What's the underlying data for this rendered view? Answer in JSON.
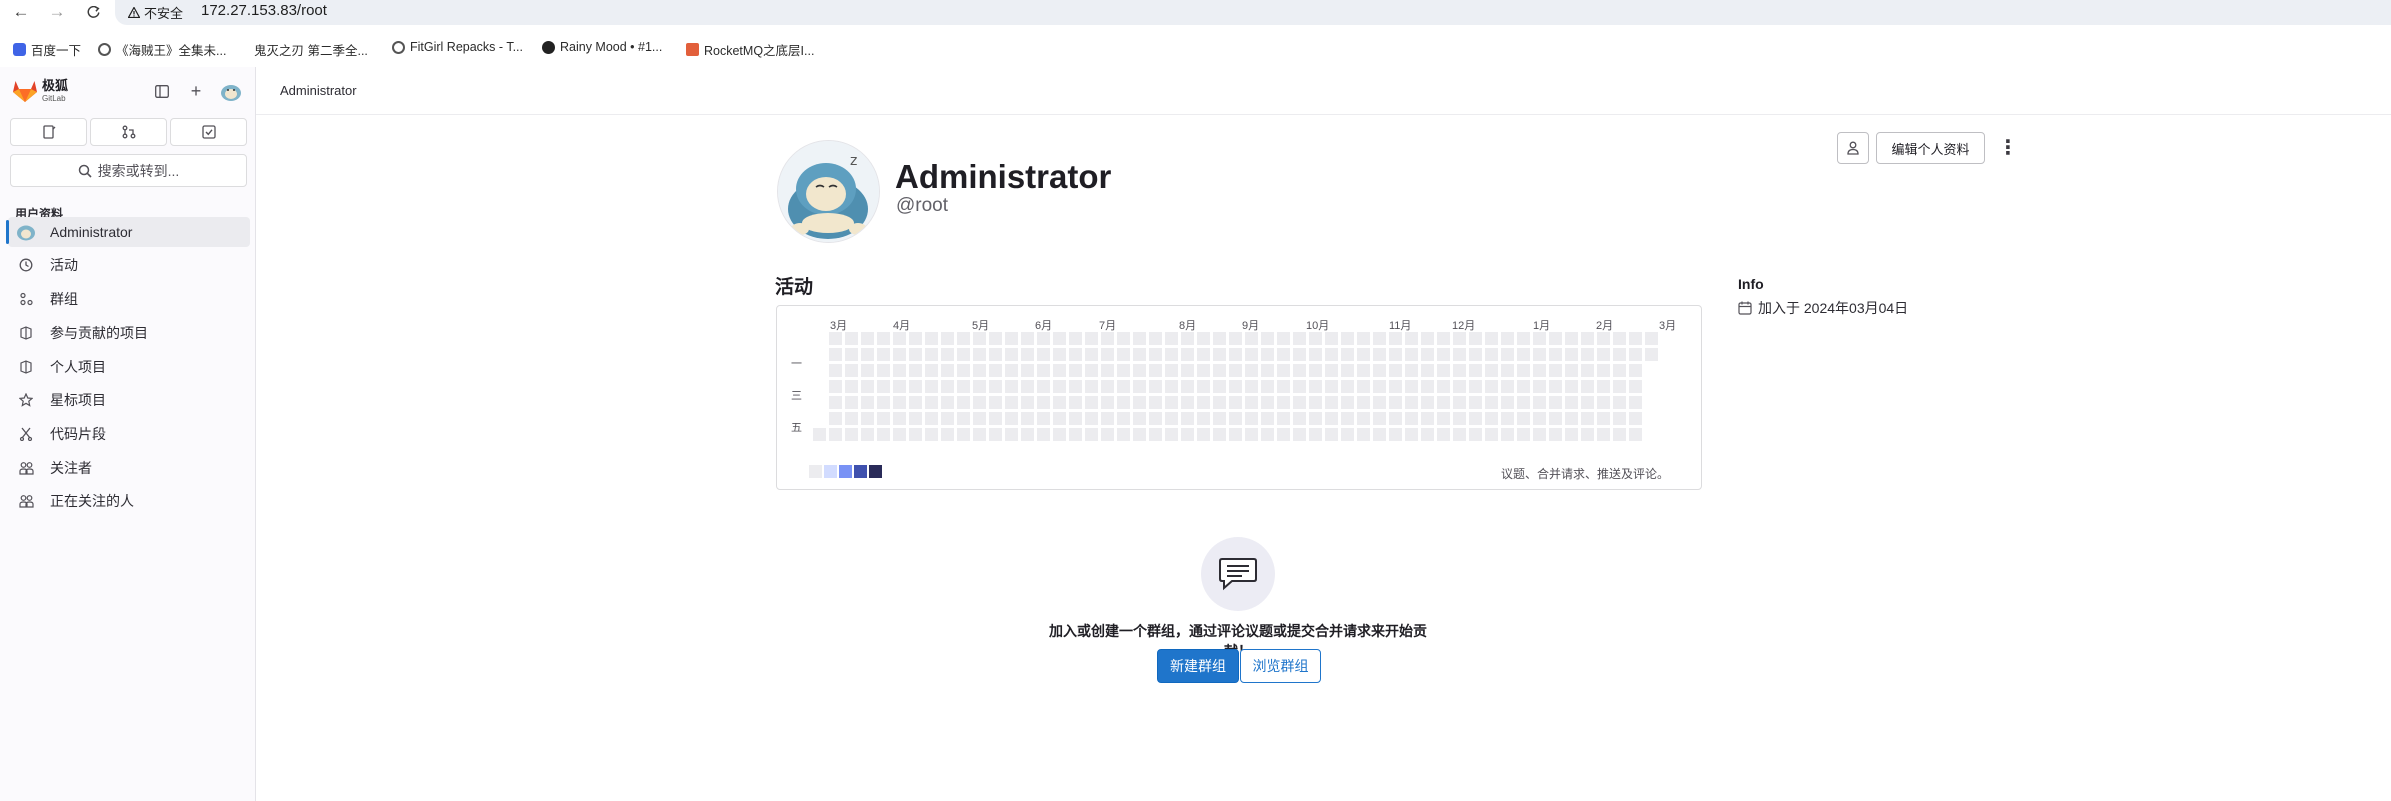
{
  "browser": {
    "insecure_label": "不安全",
    "url": "172.27.153.83/root"
  },
  "bookmarks": [
    {
      "label": "百度一下",
      "color": "#3f64e6"
    },
    {
      "label": "《海贼王》全集未...",
      "color": "#555555"
    },
    {
      "label": "鬼灭之刃 第二季全...",
      "color": "#ffffff"
    },
    {
      "label": "FitGirl Repacks - T...",
      "color": "#555555"
    },
    {
      "label": "Rainy Mood • #1...",
      "color": "#222222"
    },
    {
      "label": "RocketMQ之底层I...",
      "color": "#e25f3b"
    }
  ],
  "sidebar": {
    "brand": "极狐",
    "brand_sub": "GitLab",
    "section_title": "用户资料",
    "search_label": "搜索或转到...",
    "items": [
      {
        "label": "Administrator",
        "icon": "avatar-icon"
      },
      {
        "label": "活动",
        "icon": "history-icon"
      },
      {
        "label": "群组",
        "icon": "group-icon"
      },
      {
        "label": "参与贡献的项目",
        "icon": "project-icon"
      },
      {
        "label": "个人项目",
        "icon": "project-icon"
      },
      {
        "label": "星标项目",
        "icon": "star-icon"
      },
      {
        "label": "代码片段",
        "icon": "snippet-icon"
      },
      {
        "label": "关注者",
        "icon": "users-icon"
      },
      {
        "label": "正在关注的人",
        "icon": "users-icon"
      }
    ]
  },
  "breadcrumb": "Administrator",
  "profile": {
    "name": "Administrator",
    "username": "@root",
    "edit_button": "编辑个人资料"
  },
  "activity": {
    "title": "活动",
    "months": [
      "3月",
      "4月",
      "5月",
      "6月",
      "7月",
      "8月",
      "9月",
      "10月",
      "11月",
      "12月",
      "1月",
      "2月",
      "3月"
    ],
    "days": [
      "一",
      "三",
      "五"
    ],
    "legend_text": "议题、合并请求、推送及评论。",
    "legend_colors": [
      "#ececef",
      "#d2dcff",
      "#7992f5",
      "#3f51ae",
      "#2a2b59"
    ]
  },
  "info": {
    "title": "Info",
    "joined": "加入于 2024年03月04日"
  },
  "empty_state": {
    "text": "加入或创建一个群组，通过评论议题或提交合并请求来开始贡献！",
    "new_group": "新建群组",
    "browse_groups": "浏览群组"
  }
}
